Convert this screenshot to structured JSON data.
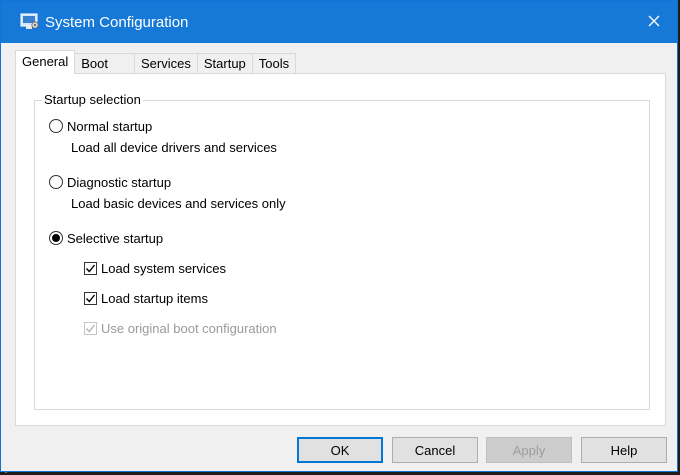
{
  "window": {
    "title": "System Configuration",
    "icons": {
      "app": "system-config-icon",
      "close": "close-icon"
    }
  },
  "tabs": [
    {
      "label": "General",
      "active": true
    },
    {
      "label": "Boot",
      "active": false
    },
    {
      "label": "Services",
      "active": false
    },
    {
      "label": "Startup",
      "active": false
    },
    {
      "label": "Tools",
      "active": false
    }
  ],
  "general": {
    "group_title": "Startup selection",
    "options": [
      {
        "label": "Normal startup",
        "description": "Load all device drivers and services",
        "selected": false
      },
      {
        "label": "Diagnostic startup",
        "description": "Load basic devices and services only",
        "selected": false
      },
      {
        "label": "Selective startup",
        "selected": true
      }
    ],
    "selective_items": [
      {
        "label": "Load system services",
        "checked": true,
        "enabled": true
      },
      {
        "label": "Load startup items",
        "checked": true,
        "enabled": true
      },
      {
        "label": "Use original boot configuration",
        "checked": true,
        "enabled": false
      }
    ]
  },
  "buttons": {
    "ok": "OK",
    "cancel": "Cancel",
    "apply": "Apply",
    "help": "Help"
  },
  "colors": {
    "titlebar": "#1679d8",
    "accent": "#0078d7"
  }
}
